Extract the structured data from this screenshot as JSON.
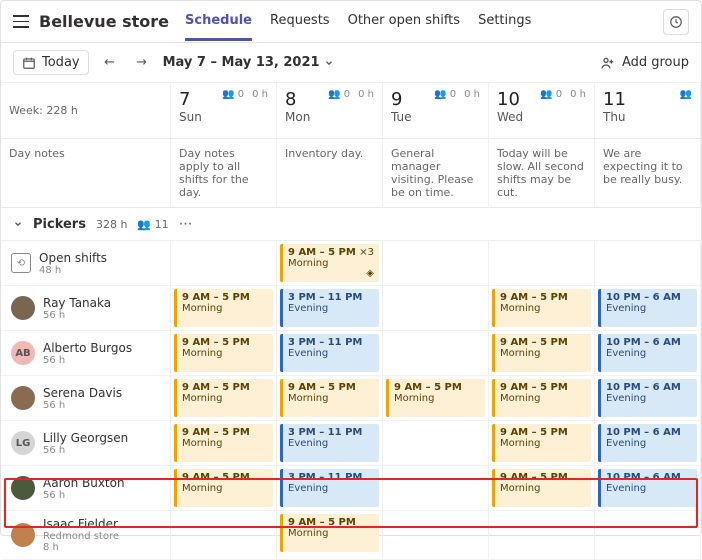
{
  "header": {
    "title": "Bellevue store",
    "tabs": [
      "Schedule",
      "Requests",
      "Other open shifts",
      "Settings"
    ],
    "active_tab": 0
  },
  "toolbar": {
    "today": "Today",
    "date_range": "May 7 – May 13, 2021",
    "add_group": "Add group"
  },
  "week_label": "Week: 228 h",
  "day_notes_label": "Day notes",
  "days": [
    {
      "num": "7",
      "name": "Sun",
      "people": "0",
      "hours": "0 h",
      "note": "Day notes apply to all shifts for the day."
    },
    {
      "num": "8",
      "name": "Mon",
      "people": "0",
      "hours": "0 h",
      "note": "Inventory day."
    },
    {
      "num": "9",
      "name": "Tue",
      "people": "0",
      "hours": "0 h",
      "note": "General manager visiting. Please be on time."
    },
    {
      "num": "10",
      "name": "Wed",
      "people": "0",
      "hours": "0 h",
      "note": "Today will be slow. All second shifts may be cut."
    },
    {
      "num": "11",
      "name": "Thu",
      "people": "",
      "hours": "",
      "note": "We are expecting it to be really busy."
    }
  ],
  "group": {
    "name": "Pickers",
    "hours": "328 h",
    "people": "11"
  },
  "open_shifts": {
    "label": "Open shifts",
    "hours": "48 h"
  },
  "members": [
    {
      "name": "Ray Tanaka",
      "hours": "56 h",
      "avatar_bg": "#7a6550"
    },
    {
      "name": "Alberto Burgos",
      "hours": "56 h",
      "avatar_bg": "#f2b8b5",
      "initials": "AB"
    },
    {
      "name": "Serena Davis",
      "hours": "56 h",
      "avatar_bg": "#8b6b50"
    },
    {
      "name": "Lilly Georgsen",
      "hours": "56 h",
      "avatar_bg": "#d5d5d5",
      "initials": "LG"
    },
    {
      "name": "Aaron Buxton",
      "hours": "56 h",
      "avatar_bg": "#4a5a3a"
    },
    {
      "name": "Isaac Fielder",
      "hours": "8 h",
      "sub": "Redmond store",
      "avatar_bg": "#c08050"
    }
  ],
  "shifts": {
    "morning": {
      "time": "9 AM – 5 PM",
      "label": "Morning"
    },
    "evening": {
      "time": "3 PM – 11 PM",
      "label": "Evening"
    },
    "late": {
      "time": "10 PM – 6 AM",
      "label": "Evening"
    }
  },
  "open_row": [
    null,
    {
      "type": "morning",
      "x3": "×3",
      "pin": true
    },
    null,
    null,
    null
  ],
  "rows": [
    [
      {
        "type": "morning"
      },
      {
        "type": "evening"
      },
      null,
      {
        "type": "morning"
      },
      {
        "type": "late"
      }
    ],
    [
      {
        "type": "morning"
      },
      {
        "type": "evening"
      },
      null,
      {
        "type": "morning"
      },
      {
        "type": "late"
      }
    ],
    [
      {
        "type": "morning"
      },
      {
        "type": "morning"
      },
      {
        "type": "morning"
      },
      {
        "type": "morning"
      },
      {
        "type": "late"
      }
    ],
    [
      {
        "type": "morning"
      },
      {
        "type": "evening"
      },
      null,
      {
        "type": "morning"
      },
      {
        "type": "late"
      }
    ],
    [
      {
        "type": "morning"
      },
      {
        "type": "evening"
      },
      null,
      {
        "type": "morning"
      },
      {
        "type": "late"
      }
    ],
    [
      null,
      {
        "type": "morning"
      },
      null,
      null,
      null
    ]
  ]
}
